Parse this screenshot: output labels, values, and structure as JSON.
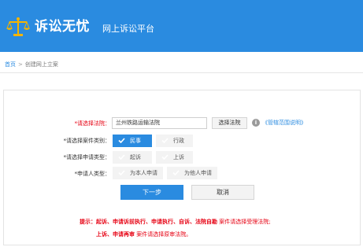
{
  "header": {
    "brand": "诉讼无忧",
    "platform": "网上诉讼平台",
    "logo_icon": "scales-icon"
  },
  "breadcrumb": {
    "home": "首页",
    "separator": ">",
    "current": "创建网上立案"
  },
  "form": {
    "court": {
      "label": "*请选择法院：",
      "value": "兰州铁路运输法院",
      "select_button": "选择法院",
      "help_link": "《管辖范围说明》"
    },
    "case_type": {
      "label": "*请选择案件类别：",
      "options": [
        "民事",
        "行政"
      ],
      "selected": "民事"
    },
    "apply_type": {
      "label": "*请选择申请类型：",
      "options": [
        "起诉",
        "上诉"
      ]
    },
    "applicant_type": {
      "label": "*申请人类型：",
      "options": [
        "为本人申请",
        "为他人申请"
      ]
    },
    "next_button": "下一步",
    "cancel_button": "取消"
  },
  "tip": {
    "prefix": "提示：",
    "line1_bold": "起诉、申请诉前执行、申请执行、自诉、法院自勘",
    "line1_rest": " 案件请选择受理法院;",
    "line2_bold": "上诉、申请再审",
    "line2_rest": " 案件请选择原审法院。"
  },
  "colors": {
    "primary": "#2a8be0",
    "required": "#e60012",
    "tip": "#e60012"
  }
}
